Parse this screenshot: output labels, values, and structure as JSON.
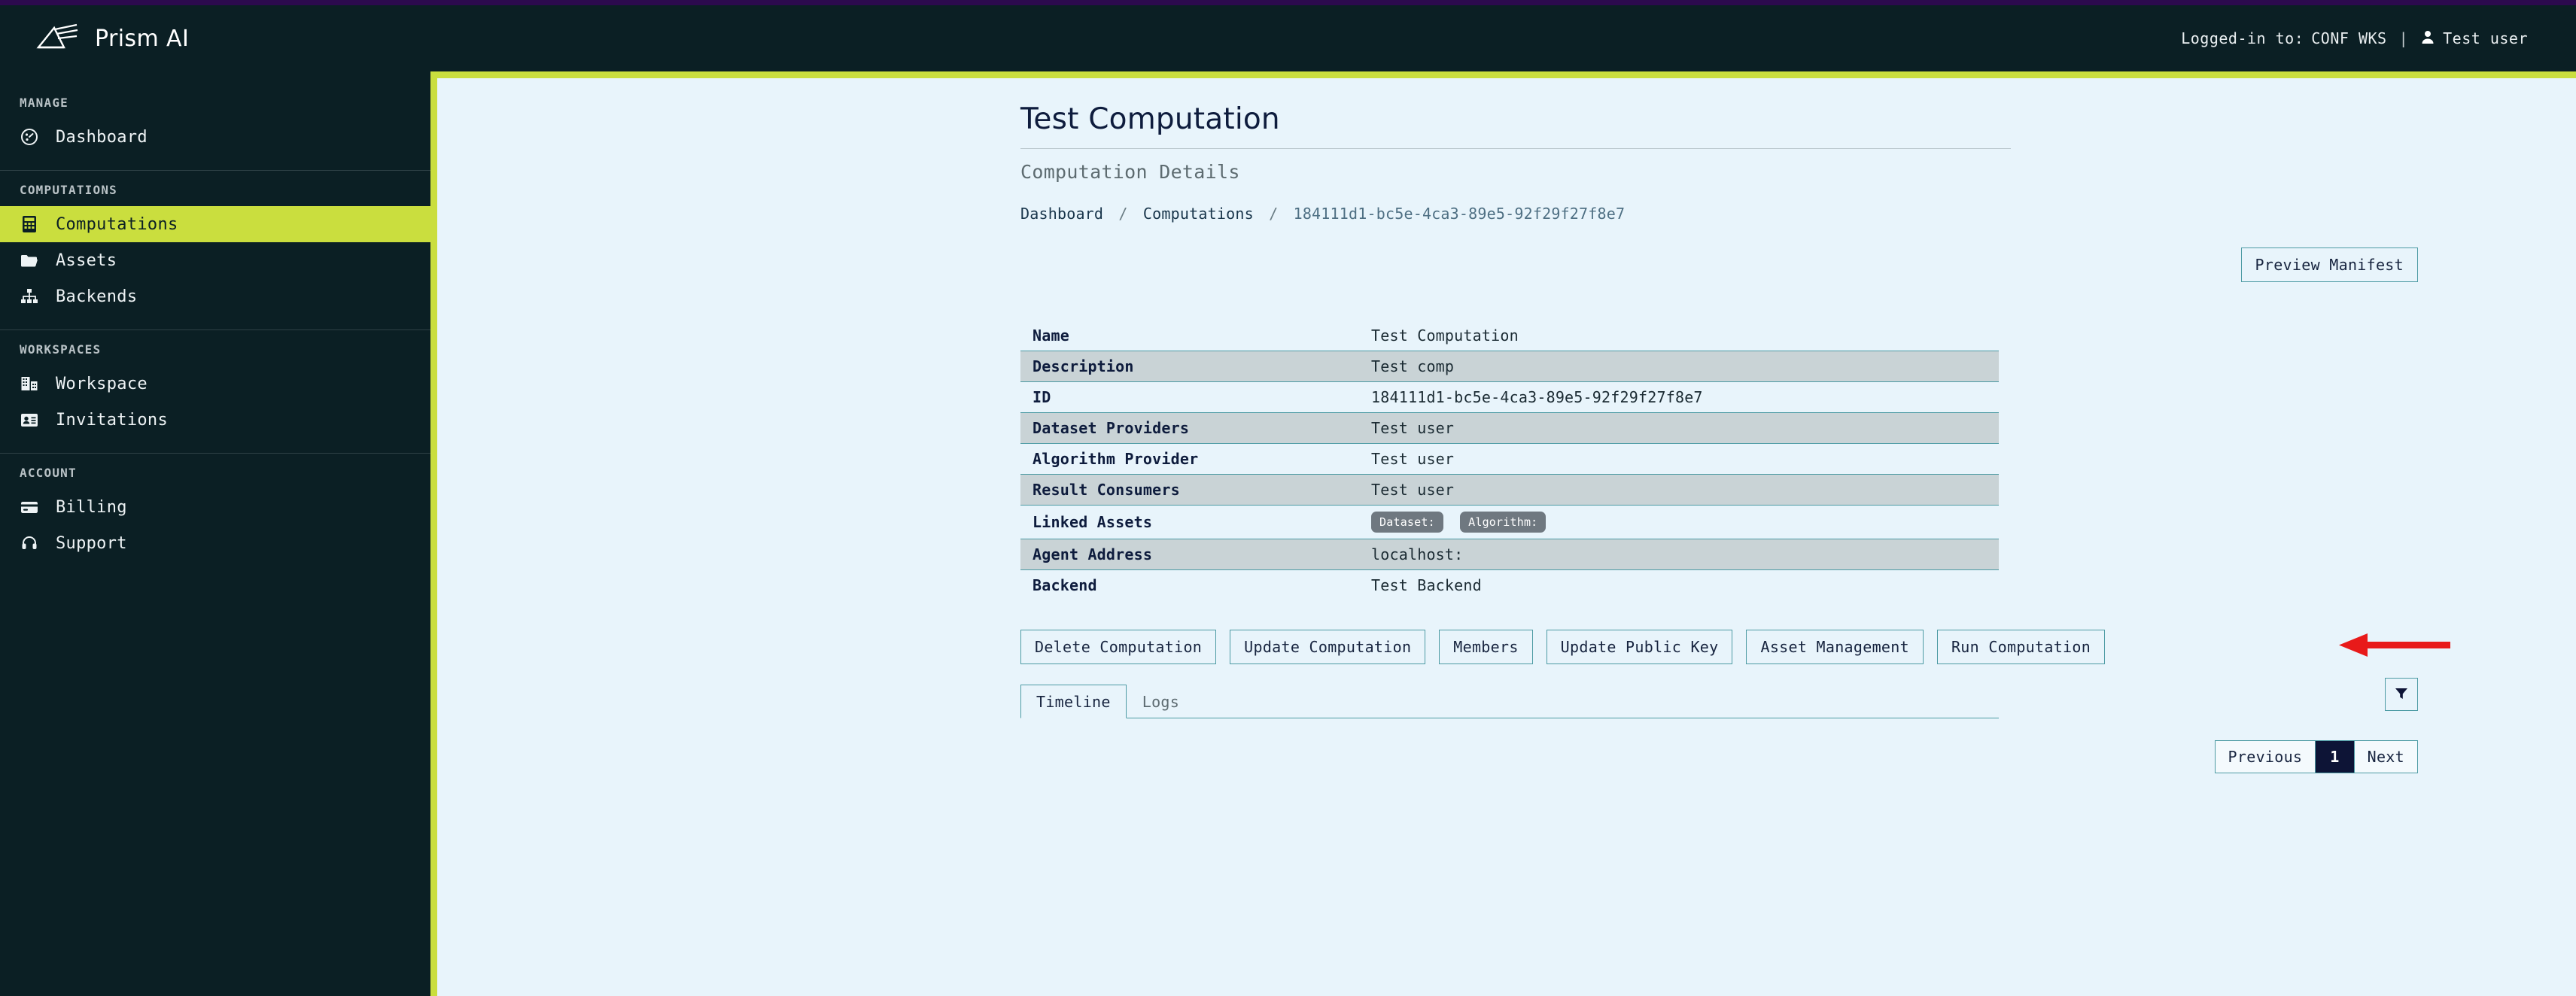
{
  "app": {
    "brand_name": "Prism AI",
    "logo_icon": "prism-logo-icon"
  },
  "header": {
    "logged_in_label": "Logged-in to:",
    "workspace": "CONF WKS",
    "separator": "|",
    "user_icon": "user-icon",
    "user_name": "Test user"
  },
  "sidebar": {
    "sections": [
      {
        "label": "MANAGE",
        "items": [
          {
            "label": "Dashboard",
            "icon": "dashboard-gauge-icon",
            "active": false
          }
        ]
      },
      {
        "label": "COMPUTATIONS",
        "items": [
          {
            "label": "Computations",
            "icon": "calculator-icon",
            "active": true
          },
          {
            "label": "Assets",
            "icon": "folder-icon",
            "active": false
          },
          {
            "label": "Backends",
            "icon": "sitemap-icon",
            "active": false
          }
        ]
      },
      {
        "label": "WORKSPACES",
        "items": [
          {
            "label": "Workspace",
            "icon": "building-icon",
            "active": false
          },
          {
            "label": "Invitations",
            "icon": "contact-card-icon",
            "active": false
          }
        ]
      },
      {
        "label": "ACCOUNT",
        "items": [
          {
            "label": "Billing",
            "icon": "credit-card-icon",
            "active": false
          },
          {
            "label": "Support",
            "icon": "headset-icon",
            "active": false
          }
        ]
      }
    ]
  },
  "main": {
    "title": "Test Computation",
    "subtitle": "Computation Details",
    "breadcrumb": {
      "items": [
        "Dashboard",
        "Computations",
        "184111d1-bc5e-4ca3-89e5-92f29f27f8e7"
      ],
      "separator": "/"
    },
    "preview_manifest_label": "Preview Manifest",
    "details": [
      {
        "key": "Name",
        "value": "Test Computation"
      },
      {
        "key": "Description",
        "value": "Test comp"
      },
      {
        "key": "ID",
        "value": "184111d1-bc5e-4ca3-89e5-92f29f27f8e7"
      },
      {
        "key": "Dataset Providers",
        "value": "Test user"
      },
      {
        "key": "Algorithm Provider",
        "value": "Test user"
      },
      {
        "key": "Result Consumers",
        "value": "Test user"
      },
      {
        "key": "Linked Assets",
        "value": "",
        "badges": [
          "Dataset:",
          "Algorithm:"
        ]
      },
      {
        "key": "Agent Address",
        "value": "localhost:"
      },
      {
        "key": "Backend",
        "value": "Test Backend"
      }
    ],
    "actions": [
      "Delete Computation",
      "Update Computation",
      "Members",
      "Update Public Key",
      "Asset Management",
      "Run Computation"
    ],
    "tabs": [
      {
        "label": "Timeline",
        "active": true
      },
      {
        "label": "Logs",
        "active": false
      }
    ],
    "filter_icon": "filter-funnel-icon",
    "pagination": {
      "previous_label": "Previous",
      "current_page": "1",
      "next_label": "Next"
    },
    "annotation": {
      "icon": "red-arrow-icon",
      "points_to": "Run Computation"
    }
  },
  "colors": {
    "accent_lime": "#cade3e",
    "sidebar_bg": "#0b1f24",
    "content_bg": "#e8f4fb",
    "row_alt_bg": "#c9d3d6",
    "border_teal": "#4d9ba4",
    "navy": "#0d1436",
    "annotation_red": "#e81a1a",
    "top_strip_purple": "#2c0a4e"
  }
}
